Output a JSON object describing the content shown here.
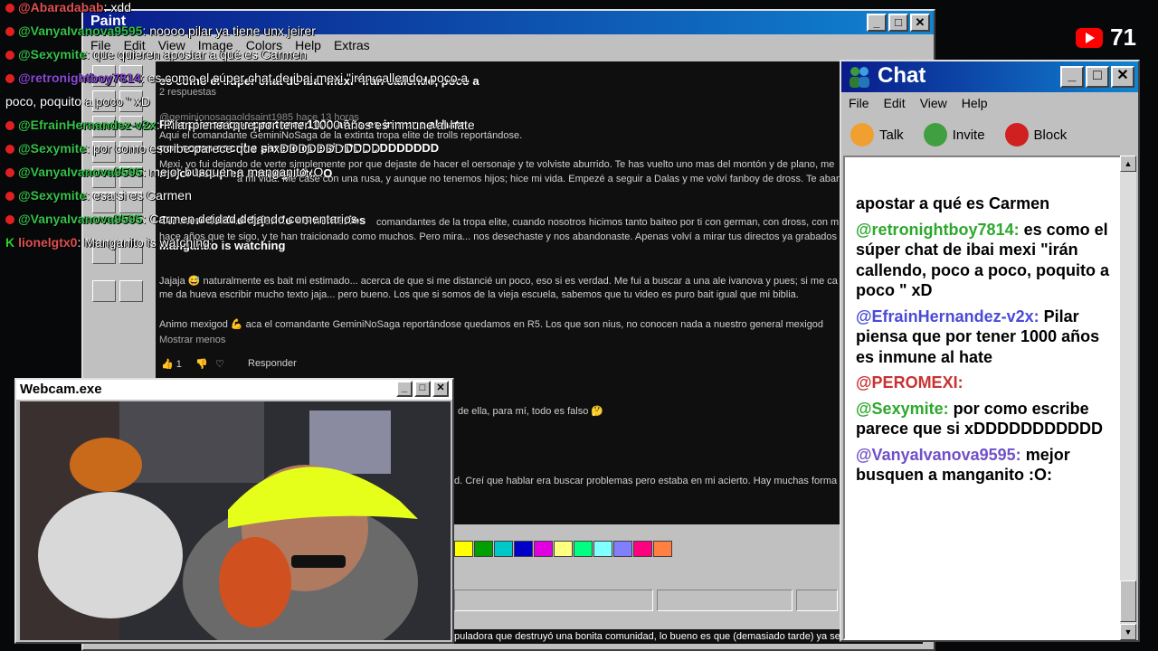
{
  "viewer_count": "71",
  "paint": {
    "title": "Paint",
    "menu": [
      "File",
      "Edit",
      "View",
      "Image",
      "Colors",
      "Help",
      "Extras"
    ],
    "canvas_lines": [
      {
        "text": "es como el súper chat de ibai mexi \"irán callendo, poco a",
        "bold": true
      },
      {
        "text": "2 respuestas",
        "bold": false
      },
      {
        "text": "@geminionosagaoldsaint1985 hace 13 horas",
        "bold": false
      },
      {
        "text": "Pilar piensa que por tener 1000 años es inmune al hate",
        "bold": true
      },
      {
        "text": "Aqui el comandante GeminiNoSaga de la extinta tropa elite de trolls reportándose.",
        "bold": false
      },
      {
        "text": "por como escribe parece que si xDDDDDDDDDDD",
        "bold": true
      },
      {
        "text": "Mexi, yo fui dejando de verte simplemente por que dejaste de hacer el oersonaje y te volviste aburrido. Te has vuelto uno mas del montón y de plano, me",
        "bold": false
      },
      {
        "text": "mejor busquen a manganito :O",
        "bold": true
      },
      {
        "text": "a mi vida. Me case con una rusa, y aunque no tenemos hijos; hice mi vida. Empezé a seguir a Dalas y me volví fanboy de dross. Te abandoné por que",
        "bold": false
      },
      {
        "text": "Carmen deidad dejando comentarios",
        "bold": true
      },
      {
        "text": "comandantes de la tropa elite, cuando nosotros hicimos tanto baiteo por ti con german, con dross, con m",
        "bold": false
      },
      {
        "text": "hace años que te sigo, y te han traicionado como muchos. Pero mira... nos desechaste y nos abandonaste. Apenas volví a mirar tus directos ya grabados",
        "bold": false
      },
      {
        "text": "Manganito is watching",
        "bold": true
      },
      {
        "text": "Jajaja 😅 naturalmente es bait mi estimado... acerca de que si me distancié un poco, eso si es verdad. Me fui a buscar a una ale ivanova y pues; si me ca",
        "bold": false
      },
      {
        "text": "me da hueva escribir mucho texto jaja... pero bueno. Los que si somos de la vieja escuela, sabemos que tu video es puro bait igual que mi biblia.",
        "bold": false
      },
      {
        "text": "Animo mexigod 💪 aca el comandante GeminiNoSaga reportándose quedamos en R5. Los que son nius, no conocen nada a nuestro general mexigod",
        "bold": false
      },
      {
        "text": "Mostrar menos",
        "bold": false
      },
      {
        "text": "Responder",
        "bold": false
      },
      {
        "text": "de ella, para mí, todo es falso 🤔",
        "bold": false
      },
      {
        "text": "d. Creí que hablar era buscar problemas pero estaba en mi acierto. Hay muchas forma",
        "bold": false
      },
      {
        "text": "puladora que destruyó una bonita comunidad, lo bueno es que (demasiado tarde) ya se",
        "bold": false
      }
    ],
    "like_count": "1",
    "palette": [
      "#ffff00",
      "#00a000",
      "#00c8c8",
      "#0000c8",
      "#e000e0",
      "#ffff80",
      "#00ff80",
      "#80ffff",
      "#8080ff",
      "#ff0080",
      "#ff8040"
    ]
  },
  "chat": {
    "title": "Chat",
    "menu": [
      "File",
      "Edit",
      "View",
      "Help"
    ],
    "actions": [
      {
        "label": "Talk",
        "icon": "talk-icon",
        "color": "#f0a030"
      },
      {
        "label": "Invite",
        "icon": "invite-icon",
        "color": "#40a040"
      },
      {
        "label": "Block",
        "icon": "block-icon",
        "color": "#d02020"
      }
    ],
    "messages": [
      {
        "user": "",
        "text": "apostar a qué es Carmen",
        "color": "#000000"
      },
      {
        "user": "@retronightboy7814:",
        "text": "es como el súper chat de ibai mexi \"irán callendo, poco a poco, poquito a poco \" xD",
        "color": "#2ca82c"
      },
      {
        "user": "@EfrainHernandez-v2x:",
        "text": "Pilar piensa que por tener 1000 años es inmune al hate",
        "color": "#4a4ad8"
      },
      {
        "user": "@PEROMEXI:",
        "text": "",
        "color": "#c83232"
      },
      {
        "user": "@Sexymite:",
        "text": "por como escribe parece que si xDDDDDDDDDDD",
        "color": "#2ca82c"
      },
      {
        "user": "@VanyaIvanova9595:",
        "text": "mejor busquen a manganito :O:",
        "color": "#7050c8"
      }
    ]
  },
  "webcam": {
    "title": "Webcam.exe"
  },
  "overlay": [
    {
      "icon": "heart",
      "user": "@Abaradabab",
      "text": ": xdd",
      "ucolor": "#e05050"
    },
    {
      "icon": "heart",
      "user": "@VanyaIvanova9595",
      "text": ": noooo pilar ya tiene unx jeirer",
      "ucolor": "#35c04a"
    },
    {
      "icon": "heart",
      "user": "@Sexymite",
      "text": ": que quieren apostar a qué es Carmen",
      "ucolor": "#35c04a"
    },
    {
      "icon": "heart",
      "user": "@retronightboy7814",
      "text": ": es como el súper chat de ibai mexi \"irán callendo, poco a",
      "ucolor": "#8a4ad8"
    },
    {
      "icon": "",
      "user": "",
      "text": "poco, poquito a poco \" xD",
      "ucolor": "#ffffff"
    },
    {
      "icon": "heart",
      "user": "@EfrainHernandez-v2x",
      "text": ": Pilar piensa que por tener 1000 años es inmune al hate",
      "ucolor": "#35c04a"
    },
    {
      "icon": "heart",
      "user": "@Sexymite",
      "text": ": por como escribe parece que si xDDDDDDDDDDD",
      "ucolor": "#35c04a"
    },
    {
      "icon": "heart",
      "user": "@VanyaIvanova9595",
      "text": ": mejor busquen a manganito :O",
      "ucolor": "#35c04a"
    },
    {
      "icon": "heart",
      "user": "@Sexymite",
      "text": ": esa si es Carmen",
      "ucolor": "#35c04a"
    },
    {
      "icon": "heart",
      "user": "@VanyaIvanova9595",
      "text": ": Carmen deidad dejando comentarios",
      "ucolor": "#35c04a"
    },
    {
      "icon": "k",
      "user": "lionelgtx0",
      "text": ": Manganito is watching",
      "ucolor": "#e05050"
    }
  ]
}
